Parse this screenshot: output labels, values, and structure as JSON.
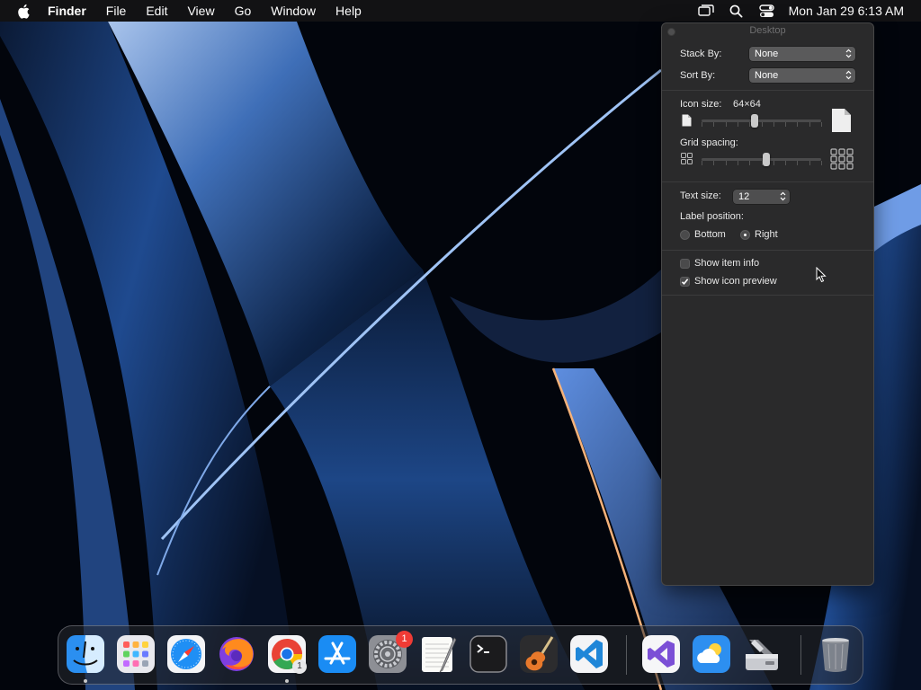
{
  "menubar": {
    "app_name": "Finder",
    "items": [
      "File",
      "Edit",
      "View",
      "Go",
      "Window",
      "Help"
    ],
    "clock": "Mon Jan 29  6:13 AM"
  },
  "panel": {
    "title": "Desktop",
    "stack_by": {
      "label": "Stack By:",
      "value": "None"
    },
    "sort_by": {
      "label": "Sort By:",
      "value": "None"
    },
    "icon_size": {
      "label": "Icon size:",
      "value": "64×64",
      "level": 0.44
    },
    "grid_spacing": {
      "label": "Grid spacing:",
      "level": 0.54
    },
    "text_size": {
      "label": "Text size:",
      "value": "12"
    },
    "label_position": {
      "label": "Label position:",
      "options": [
        "Bottom",
        "Right"
      ],
      "selected": "Right"
    },
    "show_item_info": {
      "label": "Show item info",
      "checked": false
    },
    "show_icon_preview": {
      "label": "Show icon preview",
      "checked": true
    }
  },
  "dock": {
    "apps": [
      {
        "icon": "finder-icon",
        "running": true
      },
      {
        "icon": "launchpad-icon",
        "running": false
      },
      {
        "icon": "safari-icon",
        "running": false
      },
      {
        "icon": "firefox-icon",
        "running": false
      },
      {
        "icon": "chrome-icon",
        "running": true,
        "update_badge": "1"
      },
      {
        "icon": "app-store-icon",
        "running": false
      },
      {
        "icon": "system-settings-icon",
        "running": false,
        "badge": "1"
      },
      {
        "icon": "textedit-icon",
        "running": false
      },
      {
        "icon": "terminal-icon",
        "running": false
      },
      {
        "icon": "garageband-icon",
        "running": false
      },
      {
        "icon": "vscode-icon",
        "running": false
      },
      {
        "icon": "visual-studio-icon",
        "running": false
      },
      {
        "icon": "weather-icon",
        "running": false
      },
      {
        "icon": "disk-utility-icon",
        "running": false
      },
      {
        "icon": "trash-icon",
        "running": false
      }
    ]
  },
  "colors": {
    "accent_blue": "#2a7bd6",
    "badge_red": "#ef3b35",
    "panel_bg": "#2a2a2b"
  }
}
